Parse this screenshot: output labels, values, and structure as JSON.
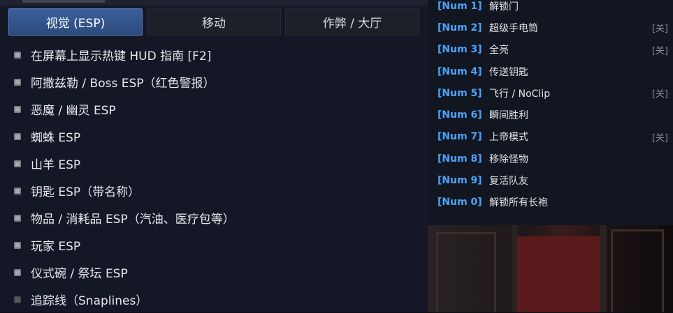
{
  "tabs": [
    {
      "label": "视觉 (ESP)",
      "active": true
    },
    {
      "label": "移动",
      "active": false
    },
    {
      "label": "作弊 / 大厅",
      "active": false
    }
  ],
  "options": [
    {
      "label": "在屏幕上显示热键 HUD 指南 [F2]",
      "checked": true
    },
    {
      "label": "阿撒兹勒 / Boss ESP（红色警报）",
      "checked": true
    },
    {
      "label": "恶魔 / 幽灵 ESP",
      "checked": true
    },
    {
      "label": "蜘蛛 ESP",
      "checked": true
    },
    {
      "label": "山羊 ESP",
      "checked": true
    },
    {
      "label": "钥匙 ESP（带名称）",
      "checked": true
    },
    {
      "label": "物品 / 消耗品 ESP（汽油、医疗包等）",
      "checked": true
    },
    {
      "label": "玩家 ESP",
      "checked": true
    },
    {
      "label": "仪式碗 / 祭坛 ESP",
      "checked": true
    },
    {
      "label": "追踪线（Snaplines）",
      "checked": false
    }
  ],
  "hotkeys": [
    {
      "key": "[Num 1]",
      "label": "解锁门",
      "state": ""
    },
    {
      "key": "[Num 2]",
      "label": "超级手电筒",
      "state": "[关]"
    },
    {
      "key": "[Num 3]",
      "label": "全亮",
      "state": "[关]"
    },
    {
      "key": "[Num 4]",
      "label": "传送钥匙",
      "state": ""
    },
    {
      "key": "[Num 5]",
      "label": "飞行 / NoClip",
      "state": "[关]"
    },
    {
      "key": "[Num 6]",
      "label": "瞬间胜利",
      "state": ""
    },
    {
      "key": "[Num 7]",
      "label": "上帝模式",
      "state": "[关]"
    },
    {
      "key": "[Num 8]",
      "label": "移除怪物",
      "state": ""
    },
    {
      "key": "[Num 9]",
      "label": "复活队友",
      "state": ""
    },
    {
      "key": "[Num 0]",
      "label": "解锁所有长袍",
      "state": ""
    }
  ],
  "colors": {
    "accent_tab": "#3a5f9b",
    "hotkey_blue": "#4aa3ff"
  }
}
